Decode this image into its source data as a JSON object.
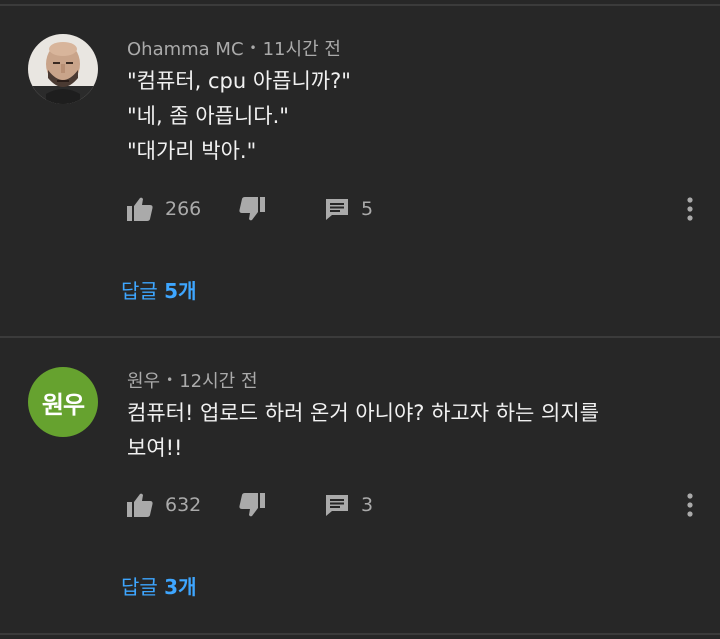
{
  "comments": [
    {
      "author": "Ohamma MC",
      "separator": "•",
      "time": "11시간 전",
      "avatar": {
        "type": "photo",
        "icon": "bald-bearded-man-avatar"
      },
      "lines": [
        "\"컴퓨터, cpu 아픕니까?\"",
        "\"네, 좀 아픕니다.\"",
        "\"대가리 박아.\""
      ],
      "likes": "266",
      "reply_count": "5",
      "replies_label": "답글",
      "replies_num": "5개"
    },
    {
      "author": "원우",
      "separator": "•",
      "time": "12시간 전",
      "avatar": {
        "type": "initials",
        "text": "원우",
        "color": "#66a22f"
      },
      "lines": [
        "컴퓨터! 업로드 하러 온거 아니야? 하고자 하는 의지를",
        "보여!!"
      ],
      "likes": "632",
      "reply_count": "3",
      "replies_label": "답글",
      "replies_num": "3개"
    }
  ],
  "colors": {
    "background": "#272727",
    "divider": "#3b3b3b",
    "link": "#3ea6ff",
    "meta": "#aaaaaa",
    "text": "#f1f1f1"
  }
}
